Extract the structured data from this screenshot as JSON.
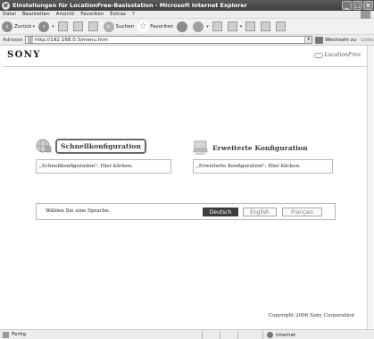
{
  "window": {
    "title": "Einstellungen für LocationFree-Basisstation - Microsoft Internet Explorer"
  },
  "menu": [
    "Datei",
    "Bearbeiten",
    "Ansicht",
    "Favoriten",
    "Extras",
    "?"
  ],
  "toolbar": {
    "back_label": "Zurück",
    "search_label": "Suchen",
    "favorites_label": "Favoriten"
  },
  "address": {
    "label": "Adresse",
    "url": "http://192.168.0.3/menu.htm",
    "go_label": "Wechseln zu",
    "links_label": "Links"
  },
  "page": {
    "brand": "SONY",
    "product_logo": "LocationFree",
    "quick": {
      "title": "Schnellkonfiguration",
      "hint": "„Schnellkonfiguration\": Hier klicken."
    },
    "advanced": {
      "title": "Erweiterte Konfiguration",
      "hint": "„Erweiterte Konfiguration\": Hier klicken."
    },
    "language": {
      "prompt": "Wählen Sie eine Sprache.",
      "options": [
        "Deutsch",
        "English",
        "Français"
      ],
      "selected": "Deutsch"
    },
    "copyright": "Copyright 2006 Sony Corporation"
  },
  "status": {
    "text": "Fertig",
    "zone": "Internet"
  }
}
